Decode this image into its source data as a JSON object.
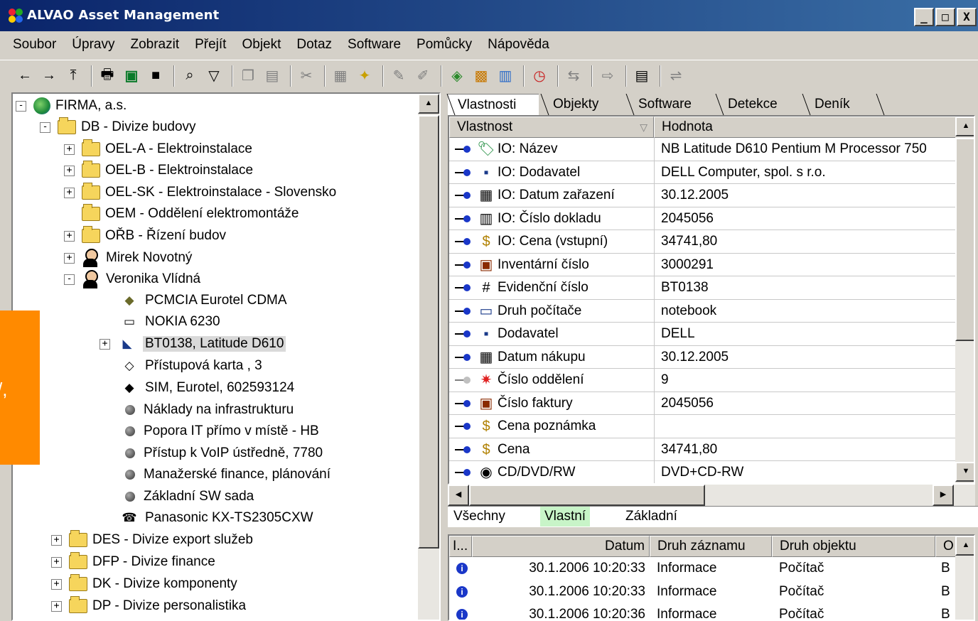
{
  "window": {
    "title": "ALVAO Asset Management",
    "controls": [
      "_",
      "□",
      "X"
    ]
  },
  "menu": [
    "Soubor",
    "Úpravy",
    "Zobrazit",
    "Přejít",
    "Objekt",
    "Dotaz",
    "Software",
    "Pomůcky",
    "Nápověda"
  ],
  "toolbar": {
    "icons": [
      "back-arrow-icon",
      "forward-arrow-icon",
      "up-folder-icon",
      "print-icon",
      "excel-icon",
      "save-icon",
      "find-icon",
      "filter-icon",
      "copy-icon",
      "paste-icon",
      "cut-icon",
      "new-object-icon",
      "wizard-icon",
      "edit-icon",
      "edit-alt-icon",
      "detect-icon",
      "report-icon",
      "sheet-icon",
      "alarm-icon",
      "move-icon",
      "export-icon",
      "clipboard-icon",
      "compare-icon"
    ]
  },
  "tree": [
    {
      "label": "FIRMA, a.s.",
      "icon": "globe-icon",
      "expander": "-"
    },
    {
      "label": "DB - Divize budovy",
      "icon": "folder-icon",
      "expander": "-"
    },
    {
      "label": "OEL-A - Elektroinstalace",
      "icon": "folder-icon",
      "expander": "+"
    },
    {
      "label": "OEL-B - Elektroinstalace",
      "icon": "folder-icon",
      "expander": "+"
    },
    {
      "label": "OEL-SK - Elektroinstalace - Slovensko",
      "icon": "folder-icon",
      "expander": "+"
    },
    {
      "label": "OEM - Oddělení elektromontáže",
      "icon": "folder-icon",
      "expander": ""
    },
    {
      "label": "OŘB - Řízení budov",
      "icon": "folder-icon",
      "expander": "+"
    },
    {
      "label": "Mirek Novotný",
      "icon": "person-icon",
      "expander": "+"
    },
    {
      "label": "Veronika Vlídná",
      "icon": "person-icon",
      "expander": "-"
    },
    {
      "label": "PCMCIA Eurotel CDMA",
      "icon": "pcmcia-card-icon",
      "expander": ""
    },
    {
      "label": "NOKIA 6230",
      "icon": "phone-icon",
      "expander": ""
    },
    {
      "label": "BT0138, Latitude D610",
      "icon": "notebook-icon",
      "expander": "+"
    },
    {
      "label": "Přístupová karta , 3",
      "icon": "access-card-icon",
      "expander": ""
    },
    {
      "label": "SIM, Eurotel, 602593124",
      "icon": "sim-card-icon",
      "expander": ""
    },
    {
      "label": "Náklady na infrastrukturu",
      "icon": "dot-icon",
      "expander": ""
    },
    {
      "label": "Popora IT přímo v místě - HB",
      "icon": "dot-icon",
      "expander": ""
    },
    {
      "label": "Přístup k VoIP ústředně, 7780",
      "icon": "dot-icon",
      "expander": ""
    },
    {
      "label": "Manažerské finance, plánování",
      "icon": "dot-icon",
      "expander": ""
    },
    {
      "label": "Základní SW sada",
      "icon": "dot-icon",
      "expander": ""
    },
    {
      "label": "Panasonic KX-TS2305CXW",
      "icon": "desk-phone-icon",
      "expander": ""
    },
    {
      "label": "DES - Divize export služeb",
      "icon": "folder-icon",
      "expander": "+"
    },
    {
      "label": "DFP - Divize finance",
      "icon": "folder-icon",
      "expander": "+"
    },
    {
      "label": "DK - Divize komponenty",
      "icon": "folder-icon",
      "expander": "+"
    },
    {
      "label": "DP - Divize personalistika",
      "icon": "folder-icon",
      "expander": "+"
    }
  ],
  "top_tabs": [
    "Vlastnosti",
    "Objekty",
    "Software",
    "Detekce",
    "Deník"
  ],
  "properties": {
    "columns": [
      "Vlastnost",
      "Hodnota"
    ],
    "rows": [
      {
        "name": "IO: Název",
        "value": "NB Latitude D610 Pentium M Processor 750",
        "icon": "name-tag-icon",
        "pin": "on"
      },
      {
        "name": "IO: Dodavatel",
        "value": "DELL Computer, spol. s r.o.",
        "icon": "supplier-icon",
        "pin": "on"
      },
      {
        "name": "IO: Datum zařazení",
        "value": "30.12.2005",
        "icon": "calendar-icon",
        "pin": "on"
      },
      {
        "name": "IO: Číslo dokladu",
        "value": "2045056",
        "icon": "barcode-icon",
        "pin": "on"
      },
      {
        "name": "IO: Cena (vstupní)",
        "value": "34741,80",
        "icon": "dollar-icon",
        "pin": "on"
      },
      {
        "name": "Inventární číslo",
        "value": "3000291",
        "icon": "book-icon",
        "pin": "on"
      },
      {
        "name": "Evidenční číslo",
        "value": "BT0138",
        "icon": "number-icon",
        "pin": "on"
      },
      {
        "name": "Druh počítače",
        "value": "notebook",
        "icon": "computer-icon",
        "pin": "on"
      },
      {
        "name": "Dodavatel",
        "value": "DELL",
        "icon": "supplier-icon",
        "pin": "on"
      },
      {
        "name": "Datum nákupu",
        "value": "30.12.2005",
        "icon": "calendar-icon",
        "pin": "on"
      },
      {
        "name": "Číslo oddělení",
        "value": "9",
        "icon": "star-icon",
        "pin": "off"
      },
      {
        "name": "Číslo faktury",
        "value": "2045056",
        "icon": "book-icon",
        "pin": "on"
      },
      {
        "name": "Cena poznámka",
        "value": "",
        "icon": "dollar-icon",
        "pin": "on"
      },
      {
        "name": "Cena",
        "value": "34741,80",
        "icon": "dollar-icon",
        "pin": "on"
      },
      {
        "name": "CD/DVD/RW",
        "value": "DVD+CD-RW",
        "icon": "cd-icon",
        "pin": "on"
      }
    ]
  },
  "bottom_tabs": [
    "Všechny",
    "Vlastní",
    "Základní"
  ],
  "log": {
    "columns": [
      "I...",
      "Datum",
      "Druh záznamu",
      "Druh objektu",
      "O"
    ],
    "rows": [
      {
        "date": "30.1.2006 10:20:33",
        "type": "Informace",
        "object": "Počítač",
        "o": "B"
      },
      {
        "date": "30.1.2006 10:20:33",
        "type": "Informace",
        "object": "Počítač",
        "o": "B"
      },
      {
        "date": "30.1.2006 10:20:36",
        "type": "Informace",
        "object": "Počítač",
        "o": "B"
      }
    ]
  },
  "overlay": {
    "text": "/,",
    "color": "#ff8a00"
  }
}
